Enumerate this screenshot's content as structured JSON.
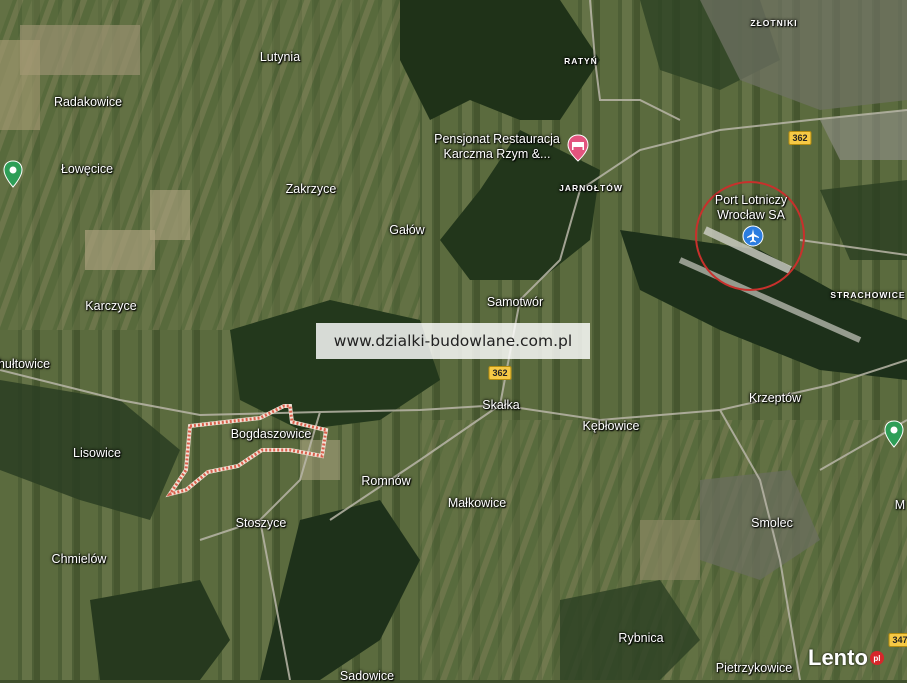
{
  "watermark": "www.dzialki-budowlane.com.pl",
  "logo": {
    "text": "Lento",
    "suffix": "pl"
  },
  "places": [
    {
      "name": "Lutynia",
      "key": "lutynia"
    },
    {
      "name": "Radakowice",
      "key": "radakowice"
    },
    {
      "name": "Łowęcice",
      "key": "lowecice"
    },
    {
      "name": "Zakrzyce",
      "key": "zakrzyce"
    },
    {
      "name": "Gałów",
      "key": "galow"
    },
    {
      "name": "Karczyce",
      "key": "karczyce"
    },
    {
      "name": "hułtowice",
      "key": "multowice"
    },
    {
      "name": "Samotwór",
      "key": "samotwor"
    },
    {
      "name": "Skałka",
      "key": "skalka"
    },
    {
      "name": "Kębłowice",
      "key": "keblowice"
    },
    {
      "name": "Krzeptów",
      "key": "krzeptow"
    },
    {
      "name": "Lisowice",
      "key": "lisowice"
    },
    {
      "name": "Bogdaszowice",
      "key": "bogdaszowice"
    },
    {
      "name": "Romnów",
      "key": "romnow"
    },
    {
      "name": "Małkowice",
      "key": "malkowice"
    },
    {
      "name": "Stoszyce",
      "key": "stoszyce"
    },
    {
      "name": "Chmielów",
      "key": "chmielow"
    },
    {
      "name": "Smolec",
      "key": "smolec"
    },
    {
      "name": "Rybnica",
      "key": "rybnica"
    },
    {
      "name": "Pietrzykowice",
      "key": "pietrzykowice"
    },
    {
      "name": "Sadowice",
      "key": "sadowice"
    },
    {
      "name": "M",
      "key": "m-edge"
    }
  ],
  "small_places": [
    {
      "name": "ZŁOTNIKI",
      "key": "zlotniki"
    },
    {
      "name": "RATYŃ",
      "key": "ratyn"
    },
    {
      "name": "JARNOŁTÓW",
      "key": "jarnoltow"
    },
    {
      "name": "STRACHOWICE",
      "key": "strachowice"
    }
  ],
  "poi": {
    "restaurant": "Pensjonat Restauracja\nKarczma Rzym &...",
    "airport": "Port Lotniczy\nWrocław SA"
  },
  "roads": {
    "r1": "362",
    "r2": "362",
    "r3": "347"
  },
  "colors": {
    "marker_green": "#2e9e57",
    "hotel_pink": "#e2547e",
    "airport_blue": "#2c7de0",
    "parcel_outline": "#e06050",
    "circle": "#c8302c"
  }
}
